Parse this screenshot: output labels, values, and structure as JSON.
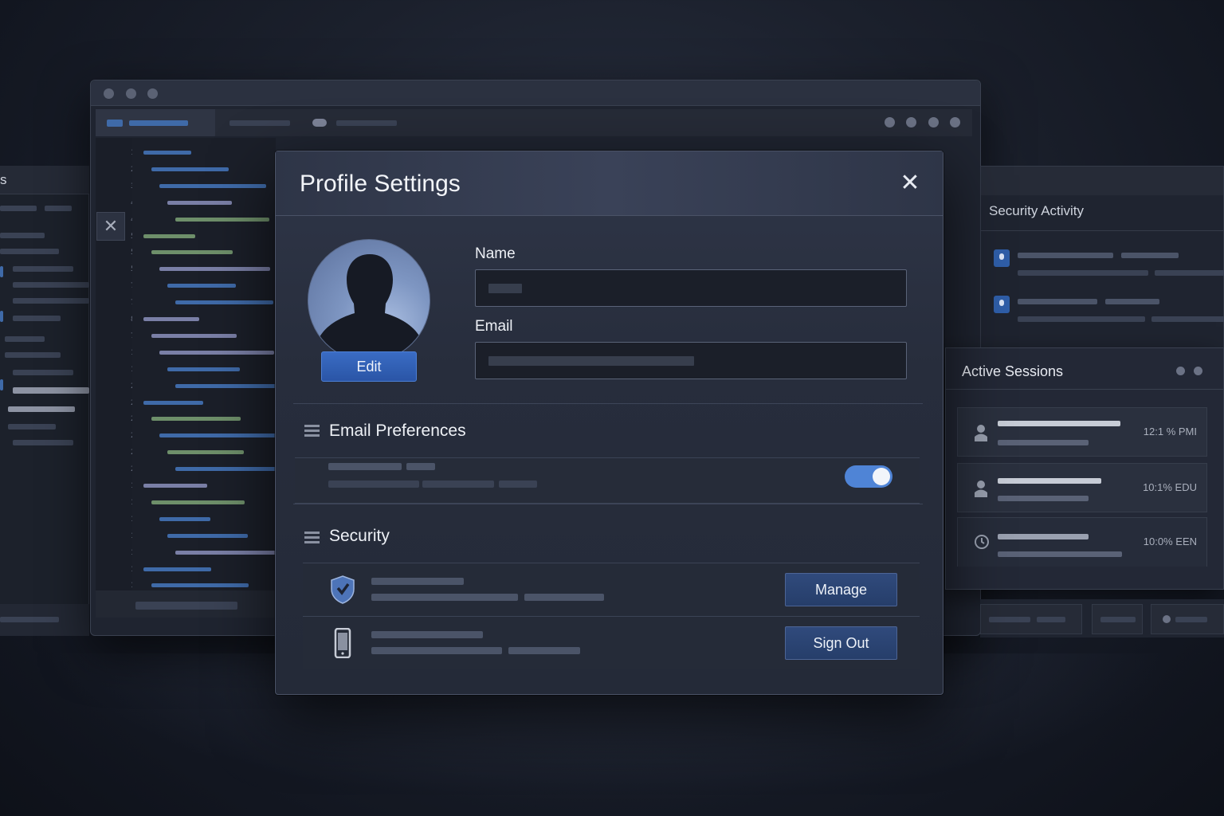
{
  "left_window": {
    "title_fragment": "s"
  },
  "editor": {
    "line_numbers": [
      "1",
      "21",
      "31",
      "44",
      "46",
      "55",
      "55",
      "55",
      "78",
      "75",
      "89",
      "78",
      "10",
      "10",
      "20",
      "21",
      "22",
      "26",
      "24",
      "23",
      "14",
      "16",
      "13",
      "17",
      "10",
      "11",
      "10"
    ]
  },
  "modal": {
    "title": "Profile Settings",
    "close_glyph": "✕",
    "avatar": {
      "edit_label": "Edit"
    },
    "fields": {
      "name_label": "Name",
      "name_value": "",
      "email_label": "Email",
      "email_value": ""
    },
    "email_preferences": {
      "title": "Email Preferences",
      "toggle_on": true
    },
    "security": {
      "title": "Security",
      "rows": [
        {
          "icon": "shield-icon",
          "button_label": "Manage"
        },
        {
          "icon": "phone-icon",
          "button_label": "Sign Out"
        }
      ]
    }
  },
  "security_activity": {
    "title": "Security Activity"
  },
  "active_sessions": {
    "title": "Active Sessions",
    "sessions": [
      {
        "icon": "user-icon",
        "time": "12:1 % PMI"
      },
      {
        "icon": "user-icon",
        "time": "10:1% EDU"
      },
      {
        "icon": "clock-icon",
        "time": "10:0% EEN"
      }
    ]
  },
  "colors": {
    "accent": "#2a55a6",
    "toggle": "#4f84d6",
    "background": "#1b202c"
  }
}
